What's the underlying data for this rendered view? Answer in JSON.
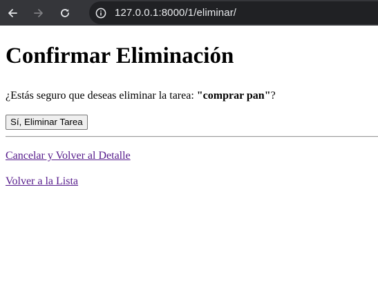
{
  "browser": {
    "url": "127.0.0.1:8000/1/eliminar/"
  },
  "page": {
    "title": "Confirmar Eliminación",
    "question_prefix": "¿Estás seguro que deseas eliminar la tarea: ",
    "task_name": "\"comprar pan\"",
    "question_suffix": "?",
    "confirm_button": "Sí, Eliminar Tarea",
    "cancel_link": "Cancelar y Volver al Detalle",
    "list_link": "Volver a la Lista"
  },
  "colors": {
    "toolbar": "#35363a",
    "omnibox": "#202124",
    "visited_link": "#551a8b"
  }
}
